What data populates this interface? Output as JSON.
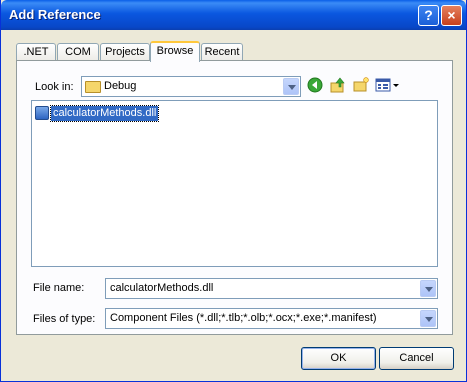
{
  "window": {
    "title": "Add Reference",
    "help_glyph": "?",
    "close_glyph": "×"
  },
  "tabs": [
    {
      "label": ".NET"
    },
    {
      "label": "COM"
    },
    {
      "label": "Projects"
    },
    {
      "label": "Browse"
    },
    {
      "label": "Recent"
    }
  ],
  "active_tab": "Browse",
  "look_in": {
    "label": "Look in:",
    "value": "Debug"
  },
  "file_list": {
    "items": [
      {
        "name": "calculatorMethods.dll",
        "selected": true
      }
    ]
  },
  "file_name": {
    "label": "File name:",
    "value": "calculatorMethods.dll"
  },
  "files_of_type": {
    "label": "Files of type:",
    "value": "Component Files (*.dll;*.tlb;*.olb;*.ocx;*.exe;*.manifest)"
  },
  "buttons": {
    "ok": "OK",
    "cancel": "Cancel"
  },
  "colors": {
    "title_bar": "#0a57e0",
    "selection": "#316ac5",
    "dialog_bg": "#ece9d8",
    "active_tab_accent": "#ffc83c"
  }
}
